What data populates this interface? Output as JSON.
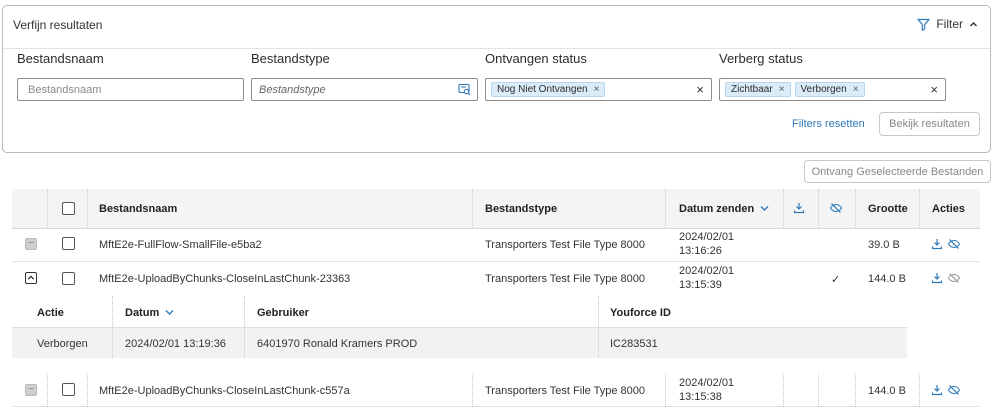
{
  "filter_panel": {
    "title": "Verfijn resultaten",
    "toggle_label": "Filter",
    "fields": {
      "filename": {
        "label": "Bestandsnaam",
        "placeholder": "Bestandsnaam"
      },
      "filetype": {
        "label": "Bestandstype",
        "placeholder": "Bestandstype"
      },
      "received": {
        "label": "Ontvangen status",
        "chips": [
          "Nog Niet Ontvangen"
        ]
      },
      "hidden": {
        "label": "Verberg status",
        "chips": [
          "Zichtbaar",
          "Verborgen"
        ]
      }
    },
    "reset_label": "Filters resetten",
    "view_label": "Bekijk resultaten"
  },
  "receive_selected_label": "Ontvang Geselecteerde Bestanden",
  "table": {
    "columns": {
      "filename": "Bestandsnaam",
      "filetype": "Bestandstype",
      "date": "Datum zenden",
      "size": "Grootte",
      "actions": "Acties"
    },
    "rows": [
      {
        "name": "MftE2e-FullFlow-SmallFile-e5ba2",
        "type": "Transporters Test File Type 8000",
        "date": "2024/02/01",
        "time": "13:16:26",
        "received": "",
        "size": "39.0 B"
      },
      {
        "name": "MftE2e-UploadByChunks-CloseInLastChunk-23363",
        "type": "Transporters Test File Type 8000",
        "date": "2024/02/01",
        "time": "13:15:39",
        "received": "✓",
        "size": "144.0 B"
      },
      {
        "name": "MftE2e-UploadByChunks-CloseInLastChunk-c557a",
        "type": "Transporters Test File Type 8000",
        "date": "2024/02/01",
        "time": "13:15:38",
        "received": "",
        "size": "144.0 B"
      }
    ],
    "subtable": {
      "columns": {
        "action": "Actie",
        "date": "Datum",
        "user": "Gebruiker",
        "youforce": "Youforce ID"
      },
      "row": {
        "action": "Verborgen",
        "date": "2024/02/01 13:19:36",
        "user": "6401970 Ronald Kramers PROD",
        "youforce": "IC283531"
      }
    }
  },
  "colors": {
    "accent": "#2f7ab8",
    "chip_bg": "#d9ecf8",
    "header_bg": "#f4f4f4"
  }
}
